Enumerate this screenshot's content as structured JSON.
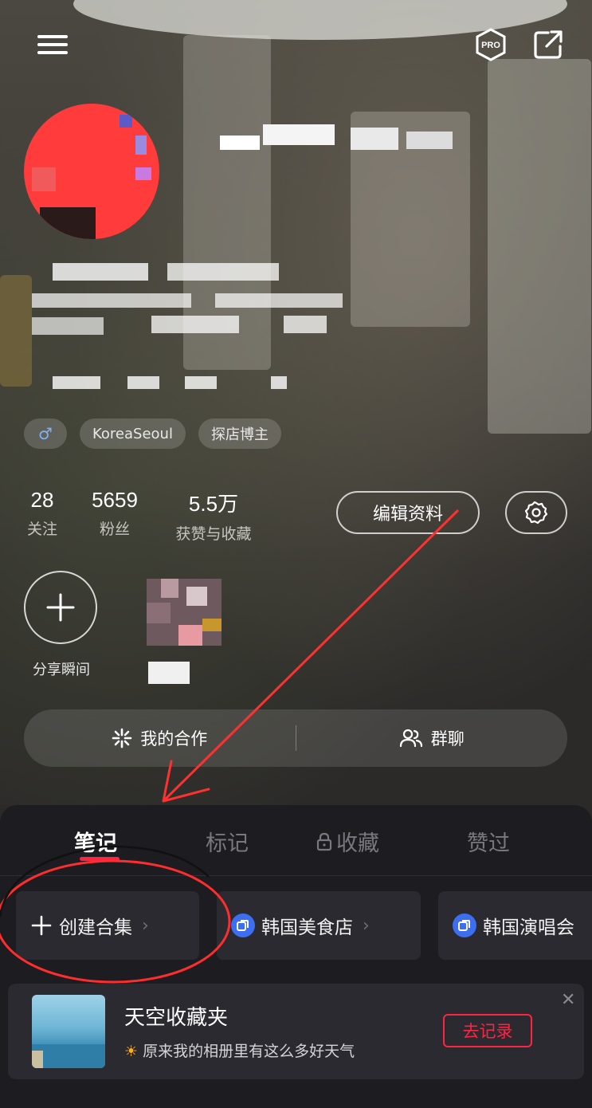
{
  "profile": {
    "tags": [
      "♂",
      "KoreaSeoul",
      "探店博主"
    ],
    "stats": [
      {
        "value": "28",
        "label": "关注"
      },
      {
        "value": "5659",
        "label": "粉丝"
      },
      {
        "value": "5.5万",
        "label": "获赞与收藏"
      }
    ],
    "edit_label": "编辑资料"
  },
  "topbar": {
    "pro_label": "PRO"
  },
  "moments": {
    "add_label": "分享瞬间"
  },
  "collab": {
    "left": "我的合作",
    "right": "群聊"
  },
  "tabs": [
    "笔记",
    "标记",
    "收藏",
    "赞过"
  ],
  "collections": {
    "create_label": "创建合集",
    "items": [
      "韩国美食店",
      "韩国演唱会"
    ]
  },
  "banner": {
    "title": "天空收藏夹",
    "subtitle": "原来我的相册里有这么多好天气",
    "button": "去记录"
  },
  "colors": {
    "accent": "#ff2442",
    "collection_icon": "#3d6ef0",
    "sheet_bg": "#1c1c21"
  }
}
